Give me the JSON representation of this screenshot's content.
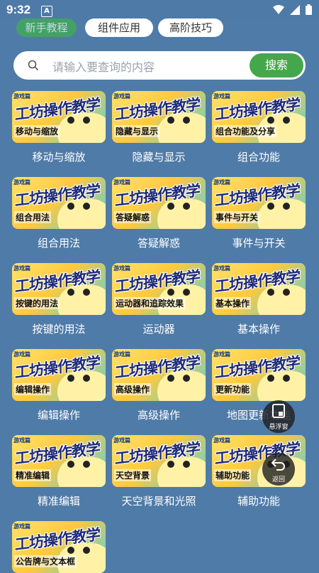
{
  "status": {
    "time": "9:32",
    "app_icon": "A"
  },
  "chips": [
    {
      "label": "新手教程"
    },
    {
      "label": "组件应用"
    },
    {
      "label": "高阶技巧"
    }
  ],
  "search": {
    "placeholder": "请输入要查询的内容",
    "button": "搜索"
  },
  "thumb_common": {
    "tag": "游戏篇",
    "big": "工坊操作教学"
  },
  "cards": [
    {
      "thumb_label": "移动与缩放",
      "caption": "移动与缩放"
    },
    {
      "thumb_label": "隐藏与显示",
      "caption": "隐藏与显示"
    },
    {
      "thumb_label": "组合功能及分享",
      "caption": "组合功能"
    },
    {
      "thumb_label": "组合用法",
      "caption": "组合用法"
    },
    {
      "thumb_label": "答疑解惑",
      "caption": "答疑解惑"
    },
    {
      "thumb_label": "事件与开关",
      "caption": "事件与开关"
    },
    {
      "thumb_label": "按键的用法",
      "caption": "按键的用法"
    },
    {
      "thumb_label": "运动器和追踪效果",
      "caption": "运动器"
    },
    {
      "thumb_label": "基本操作",
      "caption": "基本操作"
    },
    {
      "thumb_label": "编辑操作",
      "caption": "编辑操作"
    },
    {
      "thumb_label": "高级操作",
      "caption": "高级操作"
    },
    {
      "thumb_label": "更新功能",
      "caption": "地图更新功能"
    },
    {
      "thumb_label": "精准编辑",
      "caption": "精准编辑"
    },
    {
      "thumb_label": "天空背景",
      "caption": "天空背景和光照"
    },
    {
      "thumb_label": "辅助功能",
      "caption": "辅助功能"
    },
    {
      "thumb_label": "公告牌与文本框",
      "caption": ""
    }
  ],
  "floating": {
    "window_label": "悬浮窗",
    "back_label": "返回"
  },
  "colors": {
    "background": "#4f7ba8",
    "search_button": "#45a74b",
    "chip_active": "#3fb24c"
  }
}
